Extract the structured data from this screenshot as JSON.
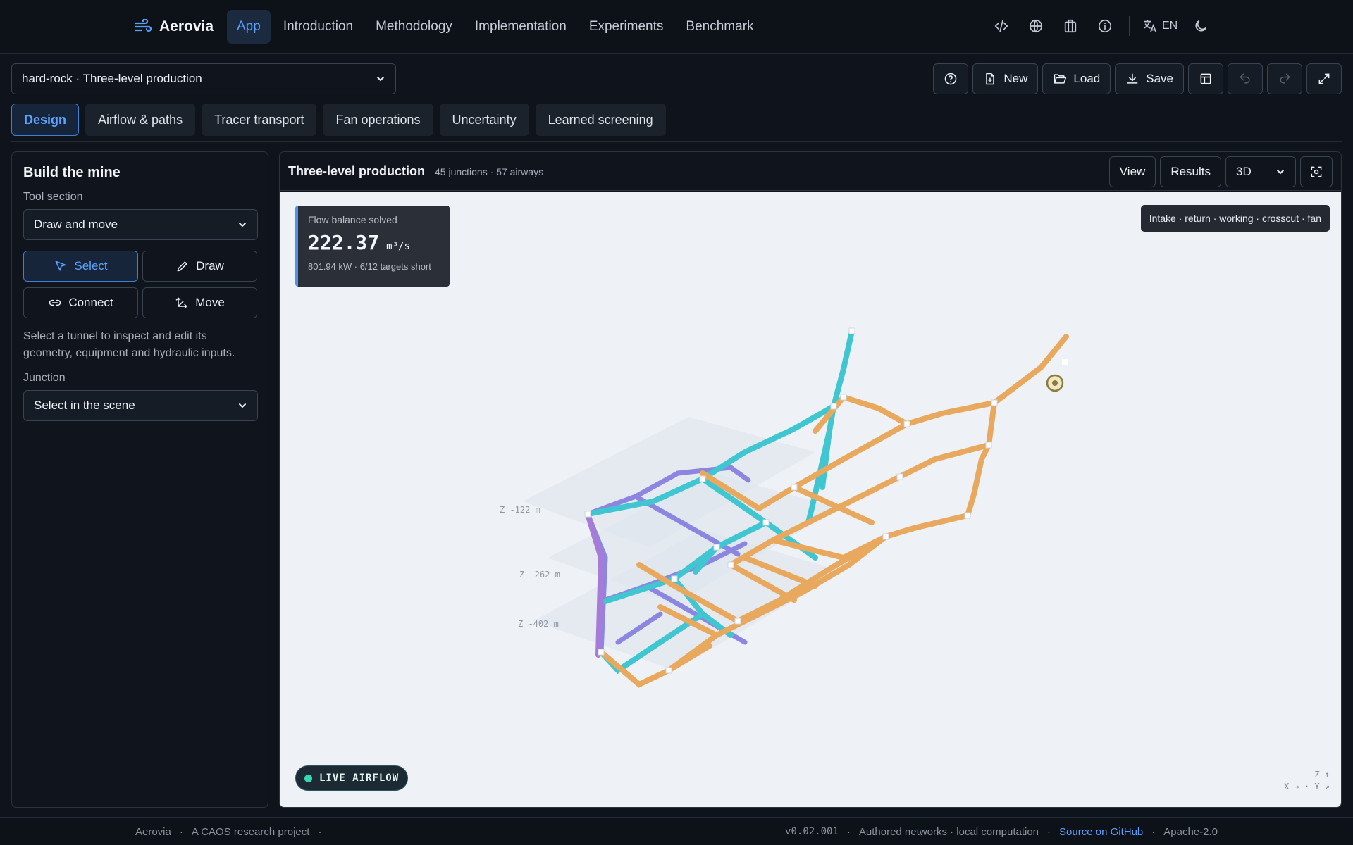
{
  "brand": {
    "name": "Aerovia"
  },
  "nav": {
    "links": [
      "App",
      "Introduction",
      "Methodology",
      "Implementation",
      "Experiments",
      "Benchmark"
    ],
    "lang": "EN"
  },
  "toolbar": {
    "scenario": "hard-rock · Three-level production",
    "new_label": "New",
    "load_label": "Load",
    "save_label": "Save"
  },
  "tabs": [
    "Design",
    "Airflow & paths",
    "Tracer transport",
    "Fan operations",
    "Uncertainty",
    "Learned screening"
  ],
  "left": {
    "title": "Build the mine",
    "tool_section_label": "Tool section",
    "tool_section_value": "Draw and move",
    "tools": [
      "Select",
      "Draw",
      "Connect",
      "Move"
    ],
    "hint": "Select a tunnel to inspect and edit its geometry, equipment and hydraulic inputs.",
    "junction_label": "Junction",
    "junction_value": "Select in the scene"
  },
  "viewport": {
    "title": "Three-level production",
    "meta": "45 junctions · 57 airways",
    "view_label": "View",
    "results_label": "Results",
    "mode": "3D",
    "flow_card": {
      "label": "Flow balance solved",
      "value": "222.37",
      "unit": "m³/s",
      "sub": "801.94 kW · 6/12 targets short"
    },
    "legend": "Intake · return · working · crosscut · fan",
    "levels": [
      "Z -122 m",
      "Z -262 m",
      "Z -402 m"
    ],
    "live_label": "LIVE AIRFLOW",
    "axes_z": "Z ↑",
    "axes_xy": "X → · Y ↗"
  },
  "colors": {
    "intake": "#3fc6d0",
    "return": "#e8a95e",
    "working": "#e8a95e",
    "crosscut": "#8d86e0",
    "shaft": "#a77bd8",
    "accent": "#5aa0ff"
  },
  "footer": {
    "name": "Aerovia",
    "project": "A CAOS research project",
    "version": "v0.02.001",
    "note": "Authored networks · local computation",
    "source": "Source on GitHub",
    "license": "Apache-2.0"
  }
}
